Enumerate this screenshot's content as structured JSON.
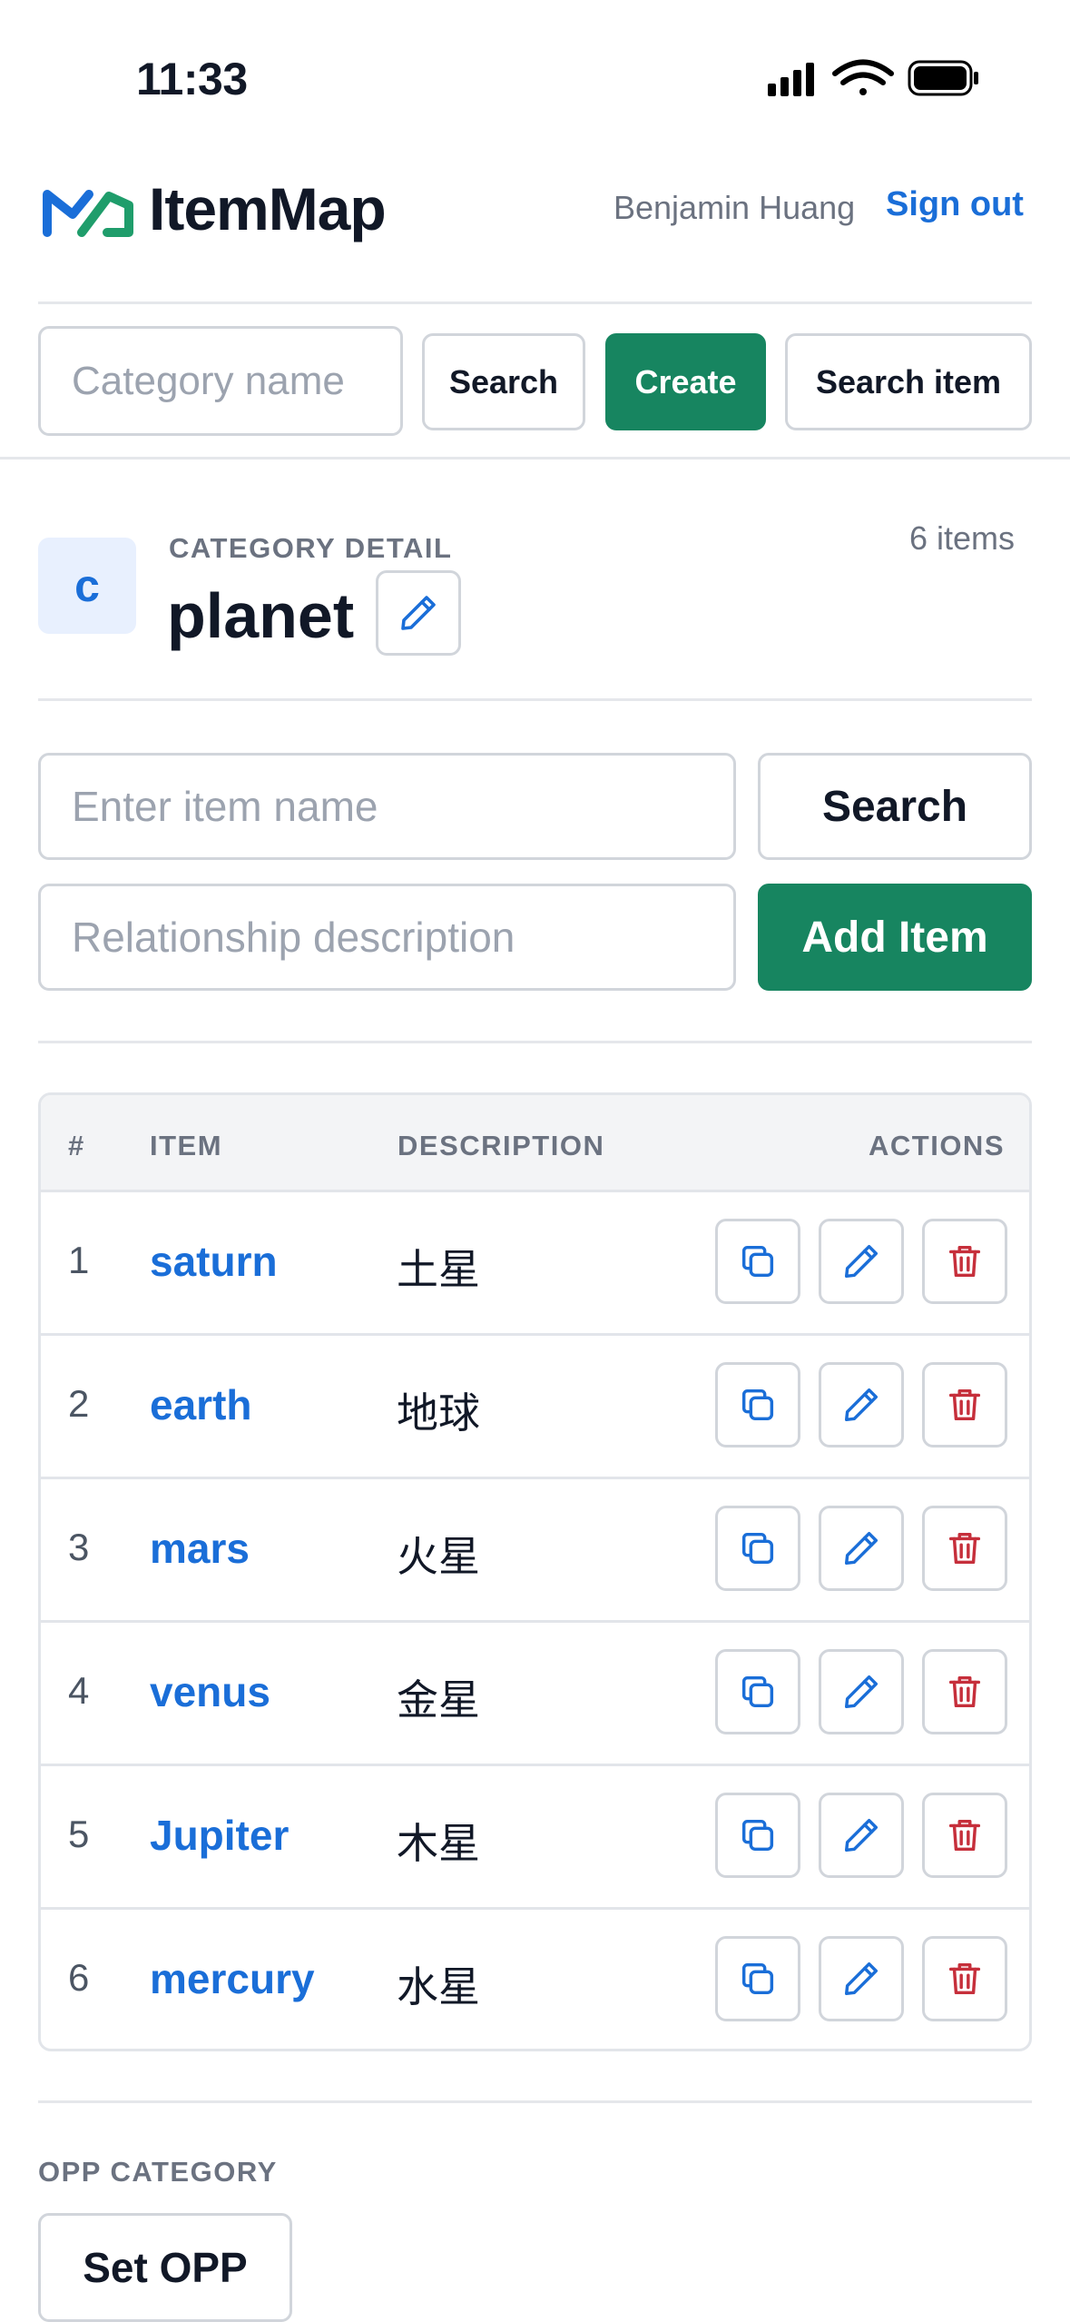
{
  "status_bar": {
    "time": "11:33"
  },
  "header": {
    "app_name": "ItemMap",
    "user_name": "Benjamin Huang",
    "sign_out_label": "Sign out"
  },
  "toolbar": {
    "category_placeholder": "Category name",
    "search_label": "Search",
    "create_label": "Create",
    "search_item_label": "Search item"
  },
  "category": {
    "avatar_letter": "c",
    "section_label": "CATEGORY DETAIL",
    "name": "planet",
    "item_count": "6 items"
  },
  "item_form": {
    "item_placeholder": "Enter item name",
    "search_label": "Search",
    "relationship_placeholder": "Relationship description",
    "add_label": "Add Item"
  },
  "table": {
    "columns": [
      "#",
      "ITEM",
      "DESCRIPTION",
      "ACTIONS"
    ],
    "rows": [
      {
        "num": "1",
        "item": "saturn",
        "description": "土星"
      },
      {
        "num": "2",
        "item": "earth",
        "description": "地球"
      },
      {
        "num": "3",
        "item": "mars",
        "description": "火星"
      },
      {
        "num": "4",
        "item": "venus",
        "description": "金星"
      },
      {
        "num": "5",
        "item": "Jupiter",
        "description": "木星"
      },
      {
        "num": "6",
        "item": "mercury",
        "description": "水星"
      }
    ]
  },
  "opp": {
    "section_label": "OPP CATEGORY",
    "set_label": "Set OPP"
  },
  "colors": {
    "brand_blue": "#1a6ed8",
    "action_green": "#178560",
    "danger_red": "#c62f3b"
  }
}
